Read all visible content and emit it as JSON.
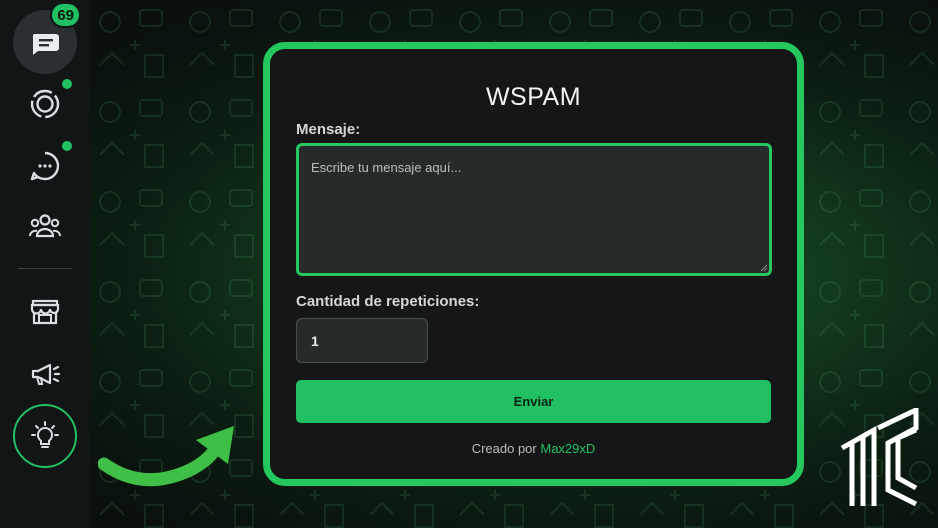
{
  "sidebar": {
    "chats_badge": "69",
    "items": [
      {
        "name": "chats",
        "icon": "chats-icon",
        "badge": "69"
      },
      {
        "name": "status",
        "icon": "status-icon",
        "dot": true
      },
      {
        "name": "channels",
        "icon": "channels-icon",
        "dot": true
      },
      {
        "name": "communities",
        "icon": "communities-icon"
      },
      {
        "name": "store",
        "icon": "store-icon"
      },
      {
        "name": "announcements",
        "icon": "megaphone-icon"
      },
      {
        "name": "ideas",
        "icon": "lightbulb-icon",
        "highlighted": true
      }
    ]
  },
  "modal": {
    "title": "WSPAM",
    "message_label": "Mensaje:",
    "message_placeholder": "Escribe tu mensaje aquí...",
    "message_value": "",
    "repeat_label": "Cantidad de repeticiones:",
    "repeat_value": "1",
    "send_label": "Enviar",
    "credit_prefix": "Creado por",
    "credit_author": "Max29xD"
  },
  "colors": {
    "accent": "#21c063",
    "border_accent": "#25c85f",
    "panel_bg": "#141617",
    "sidebar_bg": "#121516"
  }
}
